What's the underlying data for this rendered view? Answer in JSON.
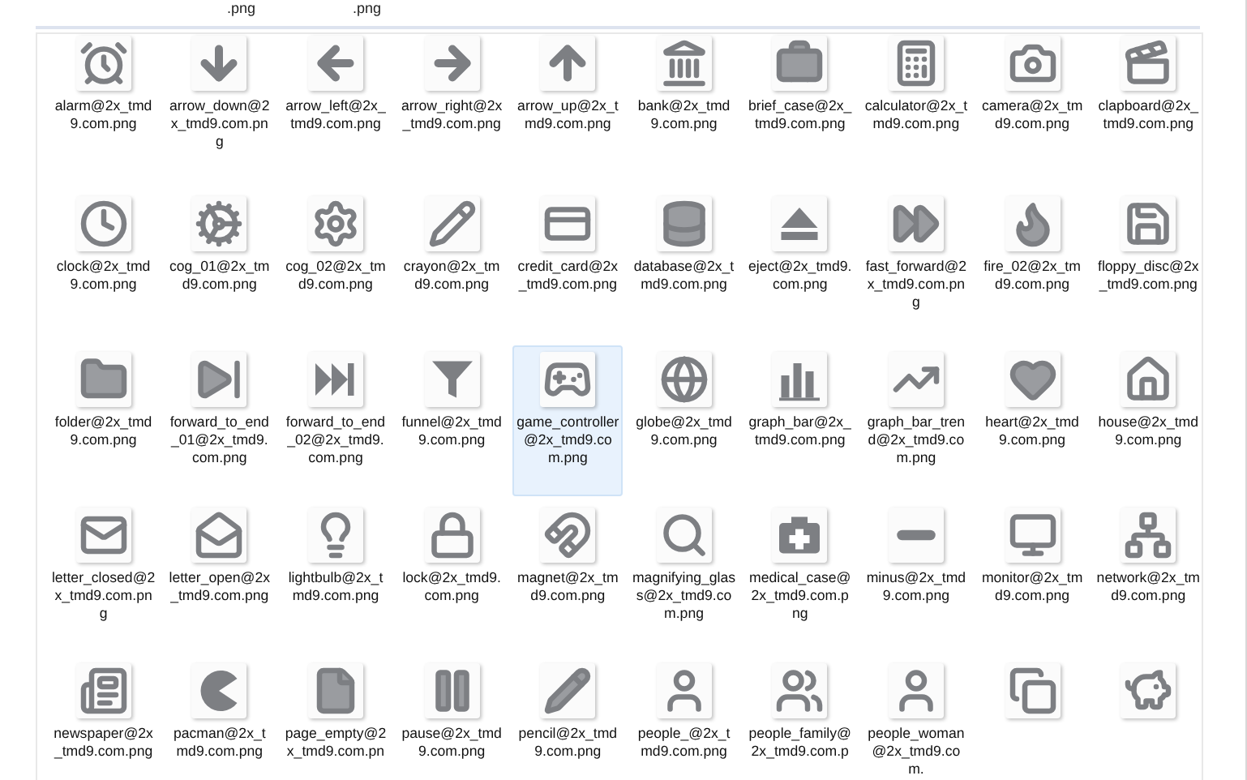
{
  "top_strip": {
    "labels": [
      ".png",
      ".png"
    ]
  },
  "items": [
    {
      "label": "alarm@2x_tmd9.com.png",
      "selected": false
    },
    {
      "label": "arrow_down@2x_tmd9.com.png",
      "selected": false
    },
    {
      "label": "arrow_left@2x_tmd9.com.png",
      "selected": false
    },
    {
      "label": "arrow_right@2x_tmd9.com.png",
      "selected": false
    },
    {
      "label": "arrow_up@2x_tmd9.com.png",
      "selected": false
    },
    {
      "label": "bank@2x_tmd9.com.png",
      "selected": false
    },
    {
      "label": "brief_case@2x_tmd9.com.png",
      "selected": false
    },
    {
      "label": "calculator@2x_tmd9.com.png",
      "selected": false
    },
    {
      "label": "camera@2x_tmd9.com.png",
      "selected": false
    },
    {
      "label": "clapboard@2x_tmd9.com.png",
      "selected": false
    },
    {
      "label": "clock@2x_tmd9.com.png",
      "selected": false
    },
    {
      "label": "cog_01@2x_tmd9.com.png",
      "selected": false
    },
    {
      "label": "cog_02@2x_tmd9.com.png",
      "selected": false
    },
    {
      "label": "crayon@2x_tmd9.com.png",
      "selected": false
    },
    {
      "label": "credit_card@2x_tmd9.com.png",
      "selected": false
    },
    {
      "label": "database@2x_tmd9.com.png",
      "selected": false
    },
    {
      "label": "eject@2x_tmd9.com.png",
      "selected": false
    },
    {
      "label": "fast_forward@2x_tmd9.com.png",
      "selected": false
    },
    {
      "label": "fire_02@2x_tmd9.com.png",
      "selected": false
    },
    {
      "label": "floppy_disc@2x_tmd9.com.png",
      "selected": false
    },
    {
      "label": "folder@2x_tmd9.com.png",
      "selected": false
    },
    {
      "label": "forward_to_end_01@2x_tmd9.com.png",
      "selected": false
    },
    {
      "label": "forward_to_end_02@2x_tmd9.com.png",
      "selected": false
    },
    {
      "label": "funnel@2x_tmd9.com.png",
      "selected": false
    },
    {
      "label": "game_controller@2x_tmd9.com.png",
      "selected": true
    },
    {
      "label": "globe@2x_tmd9.com.png",
      "selected": false
    },
    {
      "label": "graph_bar@2x_tmd9.com.png",
      "selected": false
    },
    {
      "label": "graph_bar_trend@2x_tmd9.com.png",
      "selected": false
    },
    {
      "label": "heart@2x_tmd9.com.png",
      "selected": false
    },
    {
      "label": "house@2x_tmd9.com.png",
      "selected": false
    },
    {
      "label": "letter_closed@2x_tmd9.com.png",
      "selected": false
    },
    {
      "label": "letter_open@2x_tmd9.com.png",
      "selected": false
    },
    {
      "label": "lightbulb@2x_tmd9.com.png",
      "selected": false
    },
    {
      "label": "lock@2x_tmd9.com.png",
      "selected": false
    },
    {
      "label": "magnet@2x_tmd9.com.png",
      "selected": false
    },
    {
      "label": "magnifying_glass@2x_tmd9.com.png",
      "selected": false
    },
    {
      "label": "medical_case@2x_tmd9.com.png",
      "selected": false
    },
    {
      "label": "minus@2x_tmd9.com.png",
      "selected": false
    },
    {
      "label": "monitor@2x_tmd9.com.png",
      "selected": false
    },
    {
      "label": "network@2x_tmd9.com.png",
      "selected": false
    },
    {
      "label": "newspaper@2x_tmd9.com.png",
      "selected": false
    },
    {
      "label": "pacman@2x_tmd9.com.png",
      "selected": false
    },
    {
      "label": "page_empty@2x_tmd9.com.pn",
      "selected": false
    },
    {
      "label": "pause@2x_tmd9.com.png",
      "selected": false
    },
    {
      "label": "pencil@2x_tmd9.com.png",
      "selected": false
    },
    {
      "label": "people_@2x_tmd9.com.png",
      "selected": false
    },
    {
      "label": "people_family@2x_tmd9.com.p",
      "selected": false
    },
    {
      "label": "people_woman@2x_tmd9.com.",
      "selected": false
    },
    {
      "selected": false
    },
    {
      "selected": false
    }
  ]
}
